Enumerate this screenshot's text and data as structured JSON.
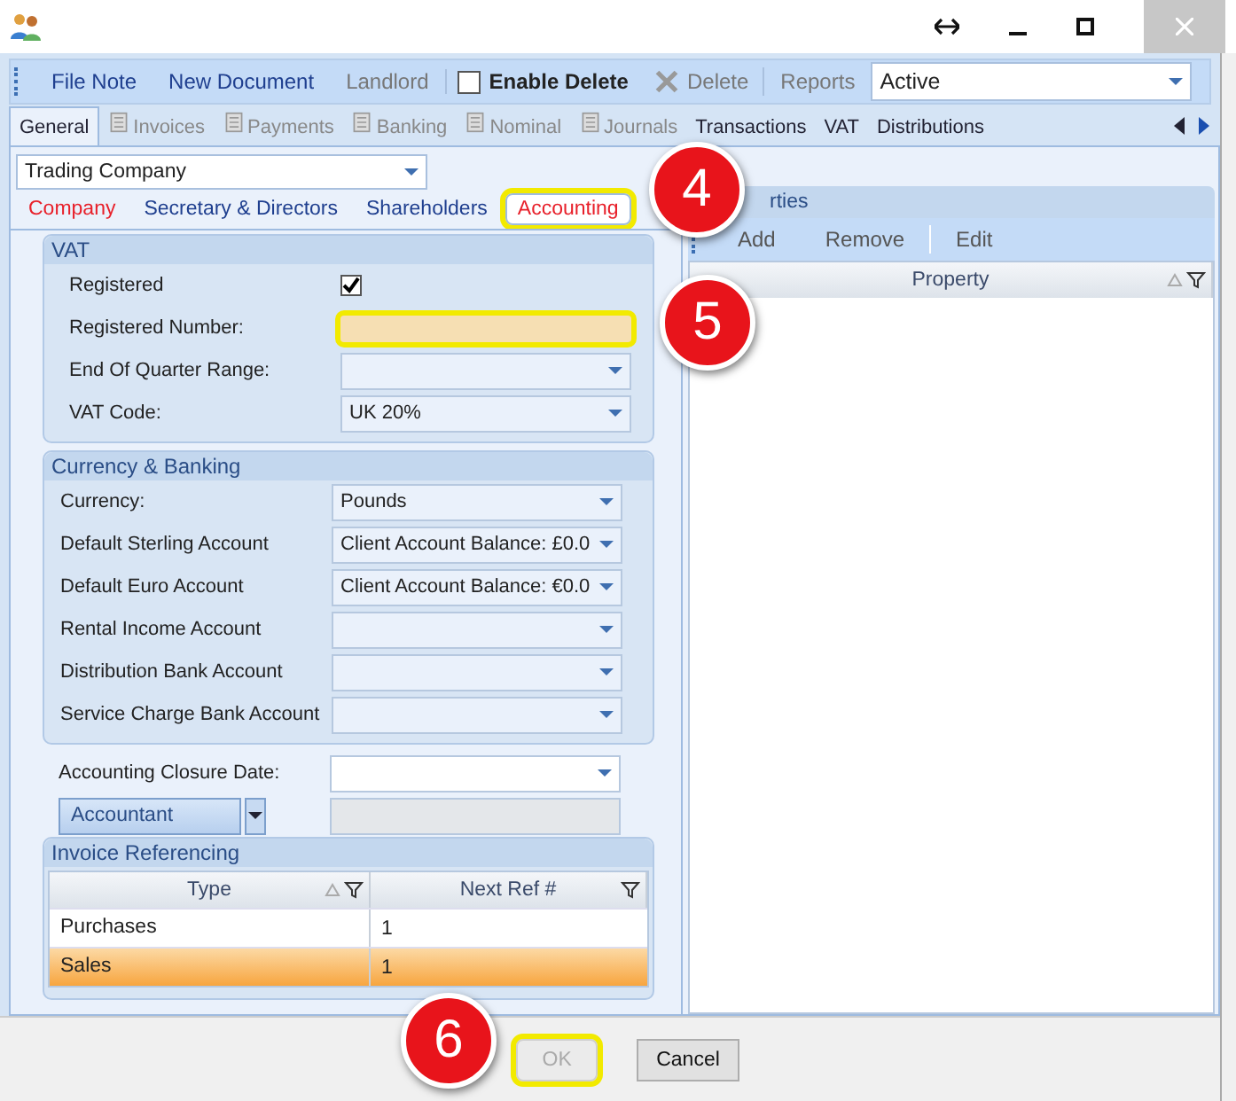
{
  "toolbar": [
    {
      "kind": "link",
      "label": "File Note",
      "disabled": false
    },
    {
      "kind": "link",
      "label": "New Document",
      "disabled": false
    },
    {
      "kind": "link",
      "label": "Landlord",
      "disabled": true
    },
    {
      "kind": "checkbox",
      "label": "Enable Delete",
      "checked": false
    },
    {
      "kind": "delete",
      "label": "Delete",
      "disabled": true
    },
    {
      "kind": "link",
      "label": "Reports",
      "disabled": true
    },
    {
      "kind": "select",
      "value": "Active"
    }
  ],
  "tabs": [
    {
      "label": "General",
      "selected": true,
      "kind": "plain",
      "disabled": false
    },
    {
      "label": "Invoices",
      "selected": false,
      "kind": "icon",
      "disabled": true
    },
    {
      "label": "Payments",
      "selected": false,
      "kind": "icon",
      "disabled": true
    },
    {
      "label": "Banking",
      "selected": false,
      "kind": "icon",
      "disabled": true
    },
    {
      "label": "Nominal",
      "selected": false,
      "kind": "icon",
      "disabled": true
    },
    {
      "label": "Journals",
      "selected": false,
      "kind": "icon",
      "disabled": true
    },
    {
      "label": "Transactions",
      "selected": false,
      "kind": "plain",
      "disabled": false
    },
    {
      "label": "VAT",
      "selected": false,
      "kind": "plain",
      "disabled": false
    },
    {
      "label": "Distributions",
      "selected": false,
      "kind": "plain",
      "disabled": false
    }
  ],
  "company_type": {
    "value": "Trading Company"
  },
  "sub_tabs": [
    {
      "label": "Company",
      "selected": false,
      "flagged": true,
      "highlighted": false
    },
    {
      "label": "Secretary & Directors",
      "selected": false,
      "flagged": false,
      "highlighted": false
    },
    {
      "label": "Shareholders",
      "selected": false,
      "flagged": false,
      "highlighted": false
    },
    {
      "label": "Accounting",
      "selected": true,
      "flagged": true,
      "highlighted": true
    }
  ],
  "vat": {
    "title": "VAT",
    "fields": [
      {
        "kind": "checkbox",
        "label": "Registered",
        "checked": true
      },
      {
        "kind": "text",
        "label": "Registered Number:",
        "highlighted": true
      },
      {
        "kind": "select",
        "label": "End Of Quarter Range:"
      },
      {
        "kind": "select",
        "label": "VAT Code:",
        "value": "UK 20%"
      }
    ]
  },
  "currency_banking": {
    "title": "Currency & Banking",
    "fields": [
      {
        "kind": "select",
        "label": "Currency:",
        "value": "Pounds"
      },
      {
        "kind": "select",
        "label": "Default Sterling Account",
        "value": "Client Account  Balance: £0.0"
      },
      {
        "kind": "select",
        "label": "Default Euro Account",
        "value": "Client Account  Balance: €0.0"
      },
      {
        "kind": "select",
        "label": "Rental Income Account"
      },
      {
        "kind": "select",
        "label": "Distribution Bank Account"
      },
      {
        "kind": "select",
        "label": "Service Charge Bank Account"
      }
    ]
  },
  "closure_date": {
    "label": "Accounting Closure Date:"
  },
  "accountant": {
    "label": "Accountant"
  },
  "invoice_referencing": {
    "title": "Invoice Referencing",
    "columns": [
      {
        "label": "Type",
        "sorted": true
      },
      {
        "label": "Next Ref #",
        "sorted": false
      }
    ],
    "rows": [
      {
        "type": "Purchases",
        "next_ref": "1",
        "selected": false
      },
      {
        "type": "Sales",
        "next_ref": "1",
        "selected": true
      }
    ]
  },
  "properties": {
    "title": "rties",
    "toolbar": [
      "Add",
      "Remove",
      "Edit"
    ],
    "columns": [
      {
        "label": "Property",
        "sorted": true
      }
    ]
  },
  "buttons": [
    {
      "label": "OK",
      "disabled": true,
      "highlighted": true
    },
    {
      "label": "Cancel",
      "disabled": false,
      "highlighted": false
    }
  ],
  "callouts": [
    "4",
    "5",
    "6"
  ]
}
